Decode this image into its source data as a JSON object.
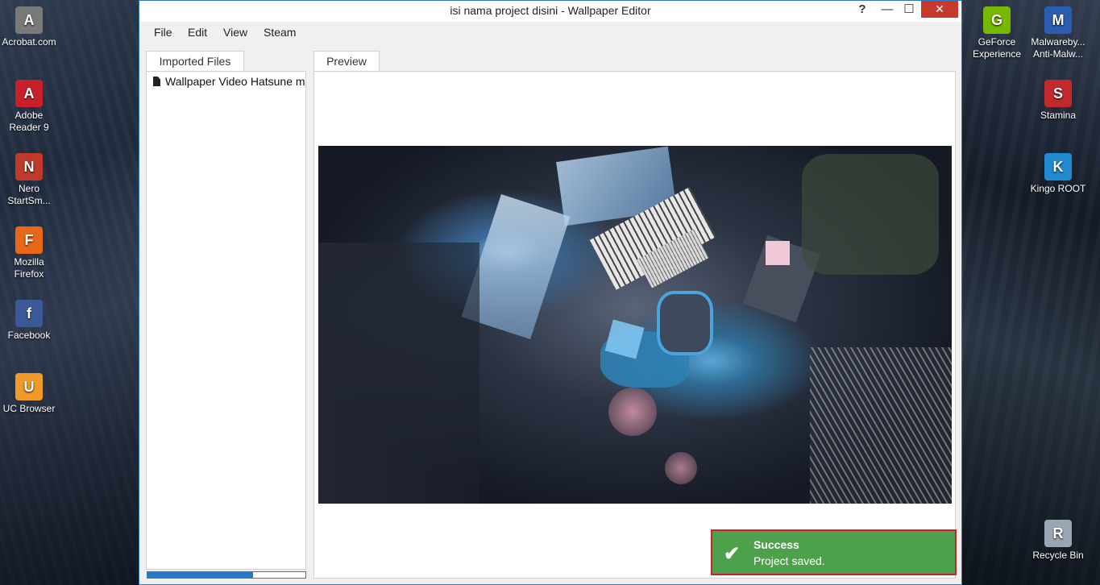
{
  "desktop": {
    "left_icons": [
      {
        "label": "Acrobat.com",
        "color": "#7a7a7a",
        "glyph": "A"
      },
      {
        "label": "Adobe Reader 9",
        "color": "#c8202a",
        "glyph": "A"
      },
      {
        "label": "Nero StartSm...",
        "color": "#c0392b",
        "glyph": "N"
      },
      {
        "label": "Mozilla Firefox",
        "color": "#e8681a",
        "glyph": "F"
      },
      {
        "label": "Facebook",
        "color": "#3b5998",
        "glyph": "f"
      },
      {
        "label": "UC Browser",
        "color": "#f09a2a",
        "glyph": "U"
      }
    ],
    "right_icons": [
      {
        "label": "GeForce Experience",
        "color": "#76b900",
        "glyph": "G"
      },
      {
        "label": "Malwareby... Anti-Malw...",
        "color": "#2a5db0",
        "glyph": "M"
      },
      {
        "label": "Stamina",
        "color": "#c02a2a",
        "glyph": "S"
      },
      {
        "label": "Kingo ROOT",
        "color": "#1f8ad0",
        "glyph": "K"
      },
      {
        "label": "Recycle Bin",
        "color": "#9aa6b4",
        "glyph": "R"
      }
    ]
  },
  "window": {
    "title": "isi nama project disini - Wallpaper Editor",
    "help": "?",
    "minimize": "—",
    "maximize": "☐",
    "close": "✕"
  },
  "menu": {
    "file": "File",
    "edit": "Edit",
    "view": "View",
    "steam": "Steam"
  },
  "imported_files": {
    "tab_label": "Imported Files",
    "items": [
      "Wallpaper Video Hatsune m"
    ],
    "progress": 0.67
  },
  "preview": {
    "tab_label": "Preview"
  },
  "toast": {
    "title": "Success",
    "message": "Project saved.",
    "check": "✔"
  }
}
